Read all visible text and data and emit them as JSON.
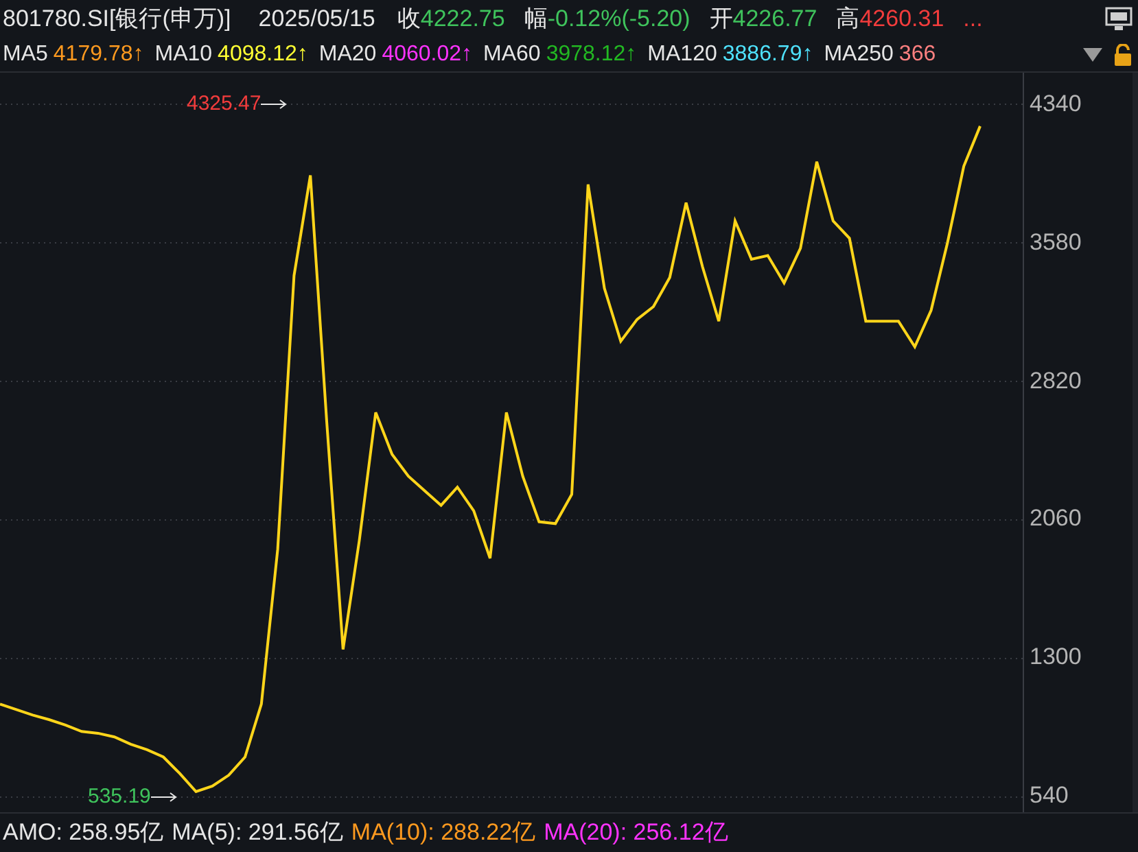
{
  "header": {
    "symbol": "801780.SI[银行(申万)]",
    "date": "2025/05/15",
    "more": "...",
    "quotes": [
      {
        "label": "收",
        "value": "4222.75",
        "color": "#3fc35c"
      },
      {
        "label": "幅",
        "value": "-0.12%(-5.20)",
        "color": "#3fc35c"
      },
      {
        "label": "开",
        "value": "4226.77",
        "color": "#3fc35c"
      },
      {
        "label": "高",
        "value": "4260.31",
        "color": "#f23c3c"
      }
    ]
  },
  "ma_legend": [
    {
      "label": "MA5",
      "value": "4179.78↑",
      "color": "#ff9a1f"
    },
    {
      "label": "MA10",
      "value": "4098.12↑",
      "color": "#ffff33"
    },
    {
      "label": "MA20",
      "value": "4060.02↑",
      "color": "#ff33ff"
    },
    {
      "label": "MA60",
      "value": "3978.12↑",
      "color": "#22b822"
    },
    {
      "label": "MA120",
      "value": "3886.79↑",
      "color": "#4fe3ff"
    },
    {
      "label": "MA250",
      "value": "366",
      "color": "#ff8080"
    }
  ],
  "chart": {
    "high_marker": "4325.47",
    "low_marker": "535.19",
    "chart_data": {
      "type": "line",
      "grid": true,
      "ylim": [
        457,
        4513
      ],
      "yticks": [
        {
          "value": 4340,
          "label": "4340"
        },
        {
          "value": 3580,
          "label": "3580"
        },
        {
          "value": 2820,
          "label": "2820"
        },
        {
          "value": 2060,
          "label": "2060"
        },
        {
          "value": 1300,
          "label": "1300"
        },
        {
          "value": 540,
          "label": "540"
        }
      ],
      "series": [
        {
          "color": "#ffd51a",
          "values": [
            1050,
            1020,
            990,
            965,
            935,
            900,
            890,
            870,
            830,
            800,
            760,
            670,
            570,
            600,
            660,
            760,
            1050,
            1900,
            3400,
            3950,
            2600,
            1350,
            1950,
            2650,
            2420,
            2300,
            2220,
            2140,
            2240,
            2110,
            1850,
            2650,
            2300,
            2050,
            2040,
            2200,
            3900,
            3330,
            3040,
            3160,
            3230,
            3390,
            3800,
            3450,
            3150,
            3700,
            3490,
            3510,
            3360,
            3550,
            4025,
            3700,
            3605,
            3150,
            3150,
            3150,
            3010,
            3210,
            3580,
            4000,
            4220
          ]
        }
      ]
    }
  },
  "volume_legend": [
    {
      "text": "AMO: 258.95亿",
      "color": "#e6e6e6"
    },
    {
      "text": "MA(5): 291.56亿",
      "color": "#e6e6e6"
    },
    {
      "text": "MA(10): 288.22亿",
      "color": "#ff9a1f"
    },
    {
      "text": "MA(20): 256.12亿",
      "color": "#ff33ff"
    }
  ]
}
